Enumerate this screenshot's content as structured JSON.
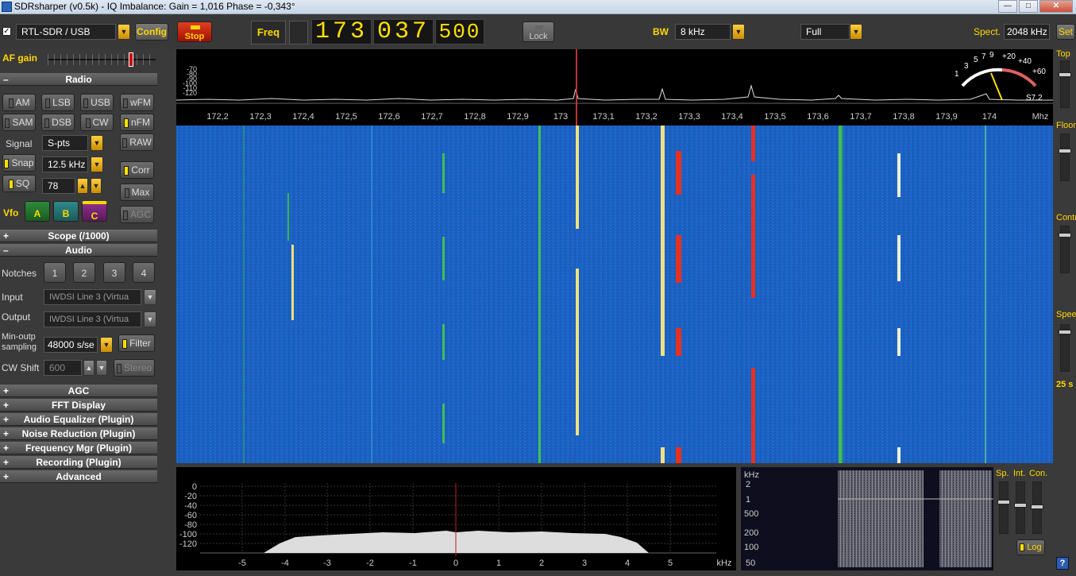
{
  "window": {
    "title": "SDRsharper (v0.5k) - IQ Imbalance: Gain = 1,016 Phase = -0,343°"
  },
  "toolbar": {
    "device": "RTL-SDR / USB",
    "config": "Config",
    "stop": "Stop",
    "freq_label": "Freq",
    "freq_digits": [
      "173",
      "037",
      "500"
    ],
    "lock": "Lock",
    "bw_label": "BW",
    "bw_value": "8 kHz",
    "zoom": "Full",
    "spect_label": "Spect.",
    "spect_value": "2048 kHz",
    "set": "Set"
  },
  "left": {
    "af_gain": "AF gain",
    "radio_header": "Radio",
    "modes": [
      "AM",
      "LSB",
      "USB",
      "wFM",
      "SAM",
      "DSB",
      "CW",
      "nFM"
    ],
    "raw": "RAW",
    "signal_label": "Signal",
    "signal_value": "S-pts",
    "snap": "Snap",
    "snap_value": "12.5 kHz",
    "corr": "Corr",
    "sq": "SQ",
    "sq_value": "78",
    "max": "Max",
    "vfo": "Vfo",
    "vfo_a": "A",
    "vfo_b": "B",
    "vfo_c": "C",
    "agc_btn": "AGC",
    "scope_header": "Scope (/1000)",
    "audio_header": "Audio",
    "notches": "Notches",
    "notch_nums": [
      "1",
      "2",
      "3",
      "4"
    ],
    "input_label": "Input",
    "input_value": "IWDSI Line 3 (Virtua",
    "output_label": "Output",
    "output_value": "IWDSI Line 3 (Virtua",
    "minout_label": "Min-outp",
    "sampling_label": "sampling",
    "sampling_value": "48000 s/se",
    "filter": "Filter",
    "cwshift_label": "CW Shift",
    "cwshift_value": "600",
    "stereo": "Stereo",
    "sections": [
      "AGC",
      "FFT Display",
      "Audio Equalizer (Plugin)",
      "Noise Reduction (Plugin)",
      "Frequency Mgr (Plugin)",
      "Recording (Plugin)",
      "Advanced"
    ]
  },
  "spectrum": {
    "freq_ticks": [
      "172,2",
      "172,3",
      "172,4",
      "172,5",
      "172,6",
      "172,7",
      "172,8",
      "172,9",
      "173",
      "173,1",
      "173,2",
      "173,3",
      "173,4",
      "173,5",
      "173,6",
      "173,7",
      "173,8",
      "173,9",
      "174"
    ],
    "unit": "Mhz",
    "db_ticks": [
      "-70",
      "-80",
      "-90",
      "-100",
      "-110",
      "-120"
    ],
    "smeter_scale": [
      "1",
      "3",
      "5",
      "7",
      "9",
      "+20",
      "+40",
      "+60"
    ],
    "smeter_reading": "S7.2"
  },
  "right": {
    "top": "Top",
    "floor": "Floor",
    "contrast": "Contr",
    "speed": "Speed",
    "speed_value": "25 s"
  },
  "scope": {
    "y_ticks": [
      "0",
      "-20",
      "-40",
      "-60",
      "-80",
      "-100",
      "-120"
    ],
    "x_ticks": [
      "-5",
      "-4",
      "-3",
      "-2",
      "-1",
      "0",
      "1",
      "2",
      "3",
      "4",
      "5"
    ],
    "unit": "kHz"
  },
  "audio_wf": {
    "unit": "kHz",
    "ticks": [
      "2",
      "1",
      "500",
      "200",
      "100",
      "50"
    ],
    "sp": "Sp.",
    "int": "Int.",
    "con": "Con.",
    "log": "Log"
  },
  "colors": {
    "accent": "#ffd700",
    "waterfall": "#2060c0",
    "stop": "#d02010"
  }
}
